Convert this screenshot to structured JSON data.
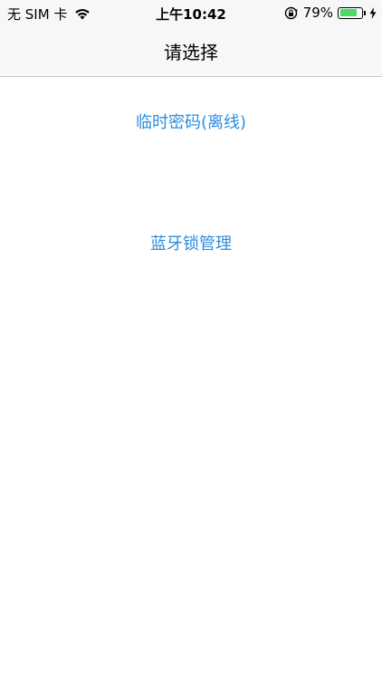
{
  "status_bar": {
    "carrier": "无 SIM 卡",
    "time": "上午10:42",
    "battery_percent": "79%",
    "battery_level": 0.79,
    "battery_color": "#4cd964"
  },
  "nav": {
    "title": "请选择"
  },
  "options": [
    {
      "label": "临时密码(离线)"
    },
    {
      "label": "蓝牙锁管理"
    }
  ],
  "colors": {
    "link": "#2b8ee0",
    "bar_background": "#f7f7f7"
  },
  "icons": [
    "wifi-icon",
    "rotation-lock-icon",
    "battery-icon",
    "charging-bolt-icon"
  ]
}
